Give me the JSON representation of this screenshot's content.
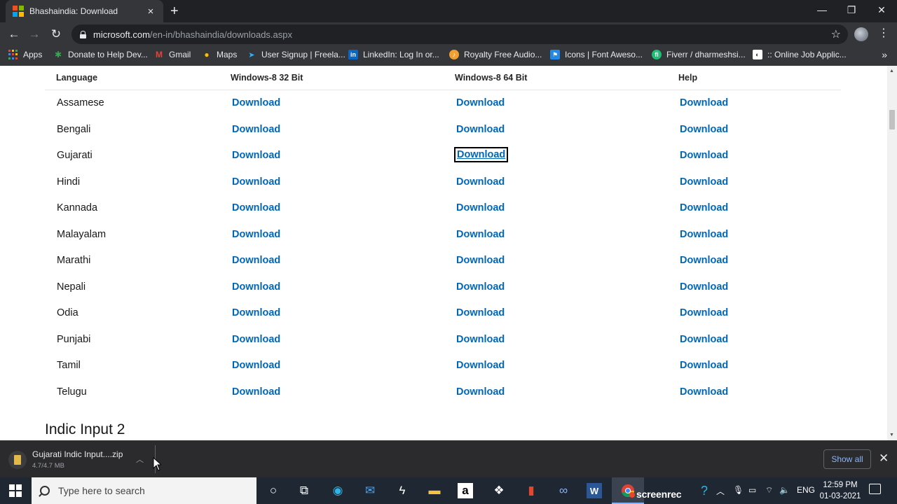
{
  "browser": {
    "tab_title": "Bhashaindia: Download",
    "url_host": "microsoft.com",
    "url_path": "/en-in/bhashaindia/downloads.aspx",
    "bookmarks": [
      {
        "label": "Apps",
        "icon": "apps-grid-icon"
      },
      {
        "label": "Donate to Help Dev...",
        "icon": "donate-icon"
      },
      {
        "label": "Gmail",
        "icon": "gmail-icon"
      },
      {
        "label": "Maps",
        "icon": "maps-pin-icon"
      },
      {
        "label": "User Signup | Freela...",
        "icon": "freelancer-icon"
      },
      {
        "label": "LinkedIn: Log In or...",
        "icon": "linkedin-icon"
      },
      {
        "label": "Royalty Free Audio...",
        "icon": "audio-icon"
      },
      {
        "label": "Icons | Font Aweso...",
        "icon": "fontawesome-flag-icon"
      },
      {
        "label": "Fiverr / dharmeshsi...",
        "icon": "fiverr-icon"
      },
      {
        "label": ":: Online Job Applic...",
        "icon": "job-icon"
      }
    ]
  },
  "table": {
    "headers": [
      "Language",
      "Windows-8 32 Bit",
      "Windows-8 64 Bit",
      "Help"
    ],
    "download_label": "Download",
    "focused_row": 2,
    "focused_col": 1,
    "rows": [
      {
        "language": "Assamese",
        "links": [
          "Download",
          "Download",
          "Download"
        ]
      },
      {
        "language": "Bengali",
        "links": [
          "Download",
          "Download",
          "Download"
        ]
      },
      {
        "language": "Gujarati",
        "links": [
          "Download",
          "Download",
          "Download"
        ]
      },
      {
        "language": "Hindi",
        "links": [
          "Download",
          "Download",
          "Download"
        ]
      },
      {
        "language": "Kannada",
        "links": [
          "Download",
          "Download",
          "Download"
        ]
      },
      {
        "language": "Malayalam",
        "links": [
          "Download",
          "Download",
          "Download"
        ]
      },
      {
        "language": "Marathi",
        "links": [
          "Download",
          "Download",
          "Download"
        ]
      },
      {
        "language": "Nepali",
        "links": [
          "Download",
          "Download",
          "Download"
        ]
      },
      {
        "language": "Odia",
        "links": [
          "Download",
          "Download",
          "Download"
        ]
      },
      {
        "language": "Punjabi",
        "links": [
          "Download",
          "Download",
          "Download"
        ]
      },
      {
        "language": "Tamil",
        "links": [
          "Download",
          "Download",
          "Download"
        ]
      },
      {
        "language": "Telugu",
        "links": [
          "Download",
          "Download",
          "Download"
        ]
      }
    ]
  },
  "section_heading": "Indic Input 2",
  "download_shelf": {
    "file_name": "Gujarati Indic Input....zip",
    "file_size": "4.7/4.7 MB",
    "show_all_label": "Show all"
  },
  "taskbar": {
    "search_placeholder": "Type here to search",
    "language": "ENG",
    "time": "12:59 PM",
    "date": "01-03-2021",
    "recorder_label": "screenrec"
  },
  "colors": {
    "link": "#0067b8",
    "chrome_dark": "#202124",
    "toolbar": "#35363a",
    "taskbar": "#1f2733",
    "show_all": "#8ab4f8"
  }
}
